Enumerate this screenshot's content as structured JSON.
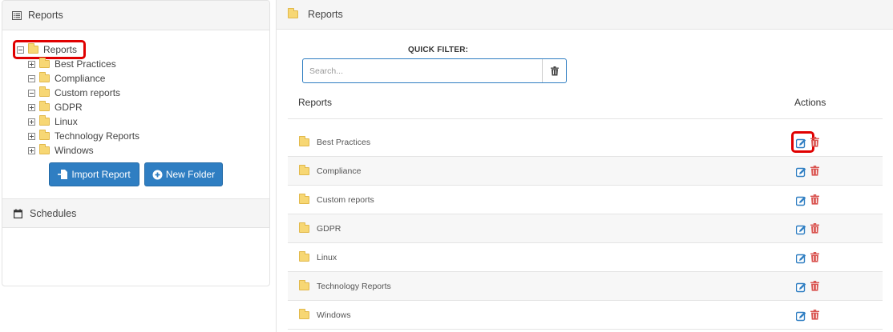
{
  "left": {
    "header_title": "Reports",
    "tree": {
      "root": "Reports",
      "children": [
        "Best Practices",
        "Compliance",
        "Custom reports",
        "GDPR",
        "Linux",
        "Technology Reports",
        "Windows"
      ]
    },
    "buttons": {
      "import": "Import Report",
      "new_folder": "New Folder"
    },
    "schedules_title": "Schedules"
  },
  "right": {
    "header_title": "Reports",
    "quick_filter_label": "QUICK FILTER:",
    "search_placeholder": "Search...",
    "columns": {
      "reports": "Reports",
      "actions": "Actions"
    },
    "rows": [
      "Best Practices",
      "Compliance",
      "Custom reports",
      "GDPR",
      "Linux",
      "Technology Reports",
      "Windows"
    ]
  },
  "colors": {
    "primary": "#2f7ec2",
    "highlight": "#e00000",
    "delete": "#d9534f",
    "folder": "#f7d774"
  }
}
